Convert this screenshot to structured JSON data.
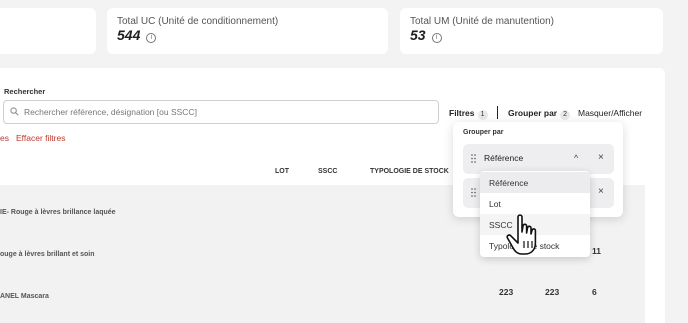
{
  "kpis": {
    "uc_label": "Total UC (Unité de conditionnement)",
    "uc_value": "544",
    "um_label": "Total UM (Unité de manutention)",
    "um_value": "53",
    "info_glyph": "i"
  },
  "search": {
    "label": "Rechercher",
    "placeholder": "Rechercher référence, désignation [ou SSCC]",
    "icon": "search-icon"
  },
  "toolbar": {
    "filters_label": "Filtres",
    "filters_count": "1",
    "group_label": "Grouper par",
    "group_count": "2",
    "mask_label": "Masquer/Afficher"
  },
  "filter_bar": {
    "prefix": "es",
    "clear_label": "Effacer filtres"
  },
  "table": {
    "columns": {
      "lot": "LOT",
      "sscc": "SSCC",
      "typology": "TYPOLOGIE DE STOCK"
    },
    "rows": [
      {
        "label": "IE- Rouge à lèvres brillance laquée"
      },
      {
        "label": "ouge à lèvres brillant et soin",
        "col3": "11"
      },
      {
        "label": "ANEL Mascara",
        "col1": "223",
        "col2": "223",
        "col3": "6"
      }
    ]
  },
  "group_by": {
    "title": "Grouper par",
    "first_value": "Référence",
    "chevron": "^",
    "remove": "×",
    "options": [
      "Référence",
      "Lot",
      "SSCC",
      "Typologie de stock"
    ]
  },
  "colors": {
    "accent_red": "#c0392b",
    "panel_bg": "#ffffff",
    "page_bg": "#f3f3f4"
  }
}
